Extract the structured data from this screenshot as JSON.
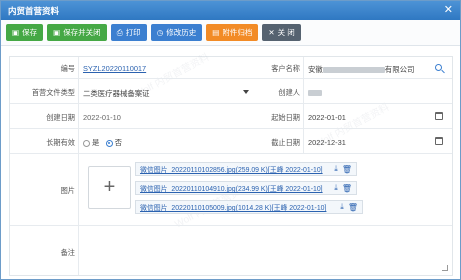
{
  "window": {
    "title": "内贸首营资料",
    "close_glyph": "✕"
  },
  "toolbar": {
    "save": "保存",
    "save_close": "保存并关闭",
    "print": "打印",
    "history": "修改历史",
    "attachments": "附件归档",
    "close": "关 闭"
  },
  "form": {
    "number_label": "编号",
    "number_value": "SYZL20220110017",
    "customer_label": "客户名称",
    "customer_prefix": "安徽",
    "customer_suffix": "有限公司",
    "doc_type_label": "首营文件类型",
    "doc_type_value": "二类医疗器械备案证",
    "creator_label": "创建人",
    "created_date_label": "创建日期",
    "created_date_value": "2022-01-10",
    "start_date_label": "起始日期",
    "start_date_value": "2022-01-01",
    "long_term_label": "长期有效",
    "long_term_yes": "是",
    "long_term_no": "否",
    "end_date_label": "截止日期",
    "end_date_value": "2022-12-31",
    "image_label": "图片",
    "upload_plus": "+",
    "remark_label": "备注"
  },
  "files": [
    {
      "text": "微信图片_20220110102856.jpg(259.09 K)[王峰 2022-01-10]"
    },
    {
      "text": "微信图片_20220110104910.jpg(234.99 K)[王峰 2022-01-10]"
    },
    {
      "text": "微信图片_20220110105009.jpg(1014.28 K)[王峰 2022-01-10]"
    }
  ],
  "icons": {
    "save": "save-icon",
    "save_close": "save-icon",
    "print": "print-icon",
    "history": "clock-icon",
    "attachments": "archive-icon",
    "close": "close-icon",
    "search": "search-icon",
    "calendar": "calendar-icon",
    "download": "download-icon",
    "delete": "trash-icon"
  },
  "colors": {
    "title_bar": "#2f78c2",
    "green_button": "#45a845",
    "blue_button": "#3b7fd0",
    "orange_button": "#f28b26",
    "dark_button": "#556270",
    "link": "#2b62b0"
  }
}
